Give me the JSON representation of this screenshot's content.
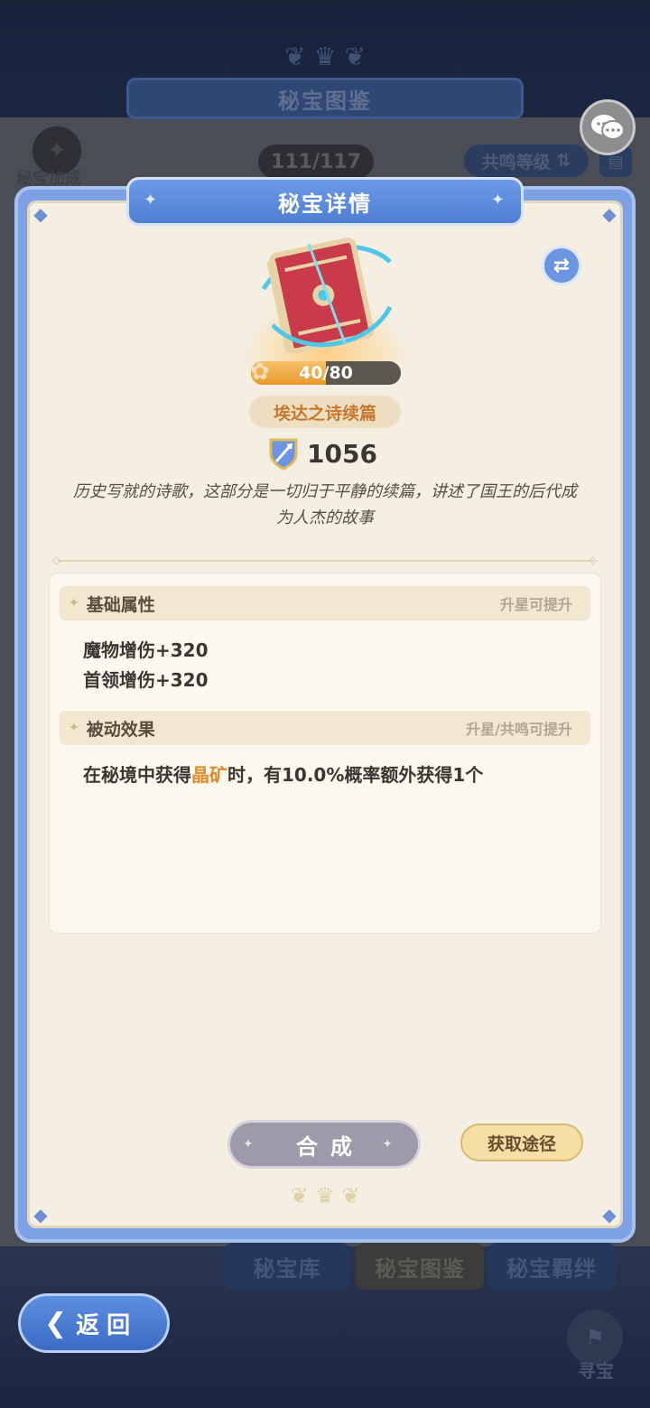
{
  "background": {
    "page_title": "秘宝图鉴",
    "collection_count": "111/117",
    "bonus_label": "秘宝加成",
    "resonance_label": "共鸣等级",
    "tabs": [
      "秘宝库",
      "秘宝图鉴",
      "秘宝羁绊"
    ],
    "hunt_label": "寻宝"
  },
  "modal": {
    "title": "秘宝详情",
    "artifact": {
      "progress_text": "40/80",
      "progress_fraction": 0.5,
      "name": "埃达之诗续篇",
      "power": "1056",
      "description": "历史写就的诗歌，这部分是一切归于平静的续篇，讲述了国王的后代成为人杰的故事"
    },
    "basic_attrs": {
      "title": "基础属性",
      "hint": "升星可提升",
      "lines": [
        "魔物增伤+320",
        "首领增伤+320"
      ]
    },
    "passive": {
      "title": "被动效果",
      "hint": "升星/共鸣可提升",
      "prefix": "在秘境中获得",
      "highlight": "晶矿",
      "suffix": "时，有10.0%概率额外获得1个"
    },
    "compose_label": "合成",
    "source_label": "获取途径"
  },
  "back_label": "返回",
  "colors": {
    "accent_blue": "#6c9ae6",
    "panel_cream": "#f4efe2",
    "highlight_orange": "#e08a28",
    "item_name_orange": "#c8782e"
  }
}
